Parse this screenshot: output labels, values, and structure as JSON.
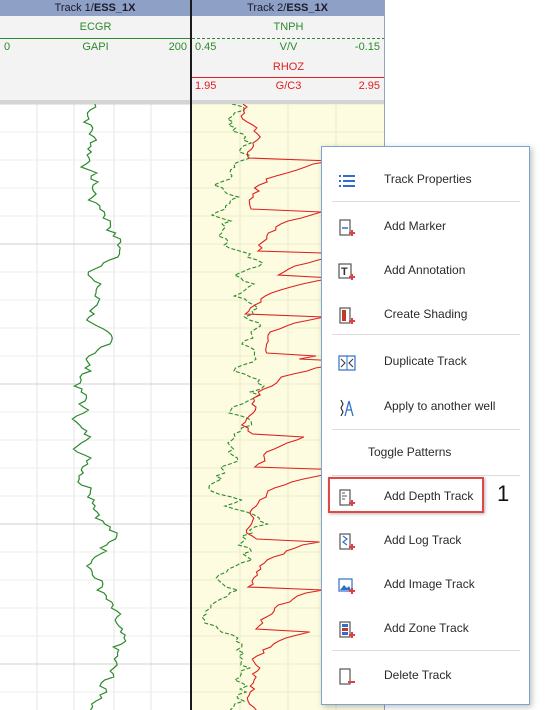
{
  "tracks": [
    {
      "title_prefix": "Track 1/",
      "title_well": "ESS_1X"
    },
    {
      "title_prefix": "Track 2/",
      "title_well": "ESS_1X"
    }
  ],
  "track1": {
    "curve": "ECGR",
    "left_scale": "0",
    "unit": "GAPI",
    "right_scale": "200"
  },
  "track2": {
    "curve1": {
      "name": "TNPH",
      "left_scale": "0.45",
      "unit": "V/V",
      "right_scale": "-0.15"
    },
    "curve2": {
      "name": "RHOZ",
      "left_scale": "1.95",
      "unit": "G/C3",
      "right_scale": "2.95"
    }
  },
  "colors": {
    "gr": "#2c8a2c",
    "rhoz": "#e02020",
    "tnph": "#2c8a2c",
    "track2_bg": "#fdfce0",
    "menu_border": "#7aa3d6",
    "highlight": "#e04848"
  },
  "menu": {
    "items": [
      {
        "label": "Track Properties",
        "icon": "list-icon"
      },
      {
        "label": "Add Marker",
        "icon": "add-marker-icon"
      },
      {
        "label": "Add Annotation",
        "icon": "add-annotation-icon"
      },
      {
        "label": "Create Shading",
        "icon": "create-shading-icon"
      },
      {
        "label": "Duplicate Track",
        "icon": "duplicate-track-icon"
      },
      {
        "label": "Apply to another well",
        "icon": "apply-well-icon"
      },
      {
        "label": "Toggle Patterns",
        "icon": ""
      },
      {
        "label": "Add Depth Track",
        "icon": "add-depth-track-icon"
      },
      {
        "label": "Add Log Track",
        "icon": "add-log-track-icon"
      },
      {
        "label": "Add Image Track",
        "icon": "add-image-track-icon"
      },
      {
        "label": "Add Zone Track",
        "icon": "add-zone-track-icon"
      },
      {
        "label": "Delete Track",
        "icon": "delete-track-icon"
      }
    ]
  },
  "callout": {
    "number": "1"
  }
}
